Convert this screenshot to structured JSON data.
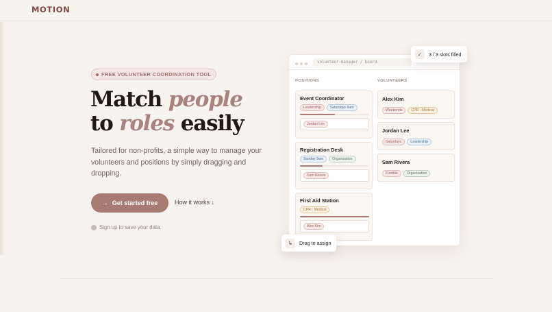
{
  "brand": {
    "logo": "MOTION"
  },
  "hero": {
    "tag": "FREE VOLUNTEER COORDINATION TOOL",
    "headline": {
      "l1_a": "Match ",
      "l1_b": "people",
      "l2_a": "to ",
      "l2_b": "roles",
      "l2_c": " easily"
    },
    "subtext": "Tailored for non-profits, a simple way to manage your volunteers and positions by simply dragging and dropping.",
    "cta_label": "Get started free",
    "how_label": "How it works ↓",
    "signup_note": "Sign up to save your data."
  },
  "board": {
    "path": "volunteer-manager / board",
    "positions_title": "POSITIONS",
    "volunteers_title": "VOLUNTEERS",
    "positions": [
      {
        "title": "Event Coordinator",
        "tags": [
          "Leadership",
          "Saturdays 9am"
        ],
        "progress": 0.5,
        "assigned": "Jordan Lee"
      },
      {
        "title": "Registration Desk",
        "tags": [
          "Sunday 9am",
          "Organization"
        ],
        "progress": 0.33,
        "assigned": "Sam Rivera"
      },
      {
        "title": "First Aid Station",
        "tags": [
          "CPR · Medical"
        ],
        "progress": 1.0,
        "assigned": "Alex Kim"
      }
    ],
    "volunteers": [
      {
        "name": "Alex Kim",
        "tags": [
          "Weekends",
          "CPR · Medical"
        ]
      },
      {
        "name": "Jordan Lee",
        "tags": [
          "Saturdays",
          "Leadership"
        ]
      },
      {
        "name": "Sam Rivera",
        "tags": [
          "Flexible",
          "Organization"
        ]
      }
    ]
  },
  "slots_badge": {
    "icon": "✓",
    "text": "3 / 3 slots filled"
  },
  "drag_badge": {
    "icon": "↳",
    "text": "Drag to assign"
  },
  "colors": {
    "accent": "#a77a73",
    "brand": "#7d4a43"
  }
}
